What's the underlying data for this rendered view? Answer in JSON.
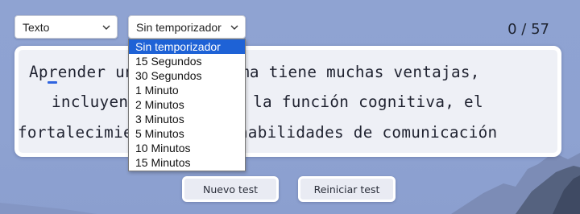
{
  "mode_select": {
    "value": "Texto"
  },
  "timer_select": {
    "value": "Sin temporizador",
    "options": [
      "Sin temporizador",
      "15 Segundos",
      "30 Segundos",
      "1 Minuto",
      "2 Minutos",
      "3 Minutos",
      "5 Minutos",
      "10 Minutos",
      "15 Minutos"
    ],
    "selected_index": 0
  },
  "counter": "0 / 57",
  "text_lines": [
    "Aprender un nuevo idioma tiene muchas ventajas,",
    "incluyendo mejora de la función cognitiva, el",
    "fortalecimiento de las habilidades de comunicación"
  ],
  "buttons": {
    "new_test": "Nuevo test",
    "restart": "Reiniciar test"
  },
  "icons": {
    "select_arrow": "chevron-down-icon"
  },
  "colors": {
    "accent": "#1e62d6",
    "caret": "#2f64e0",
    "background": "#8fa3d2"
  }
}
